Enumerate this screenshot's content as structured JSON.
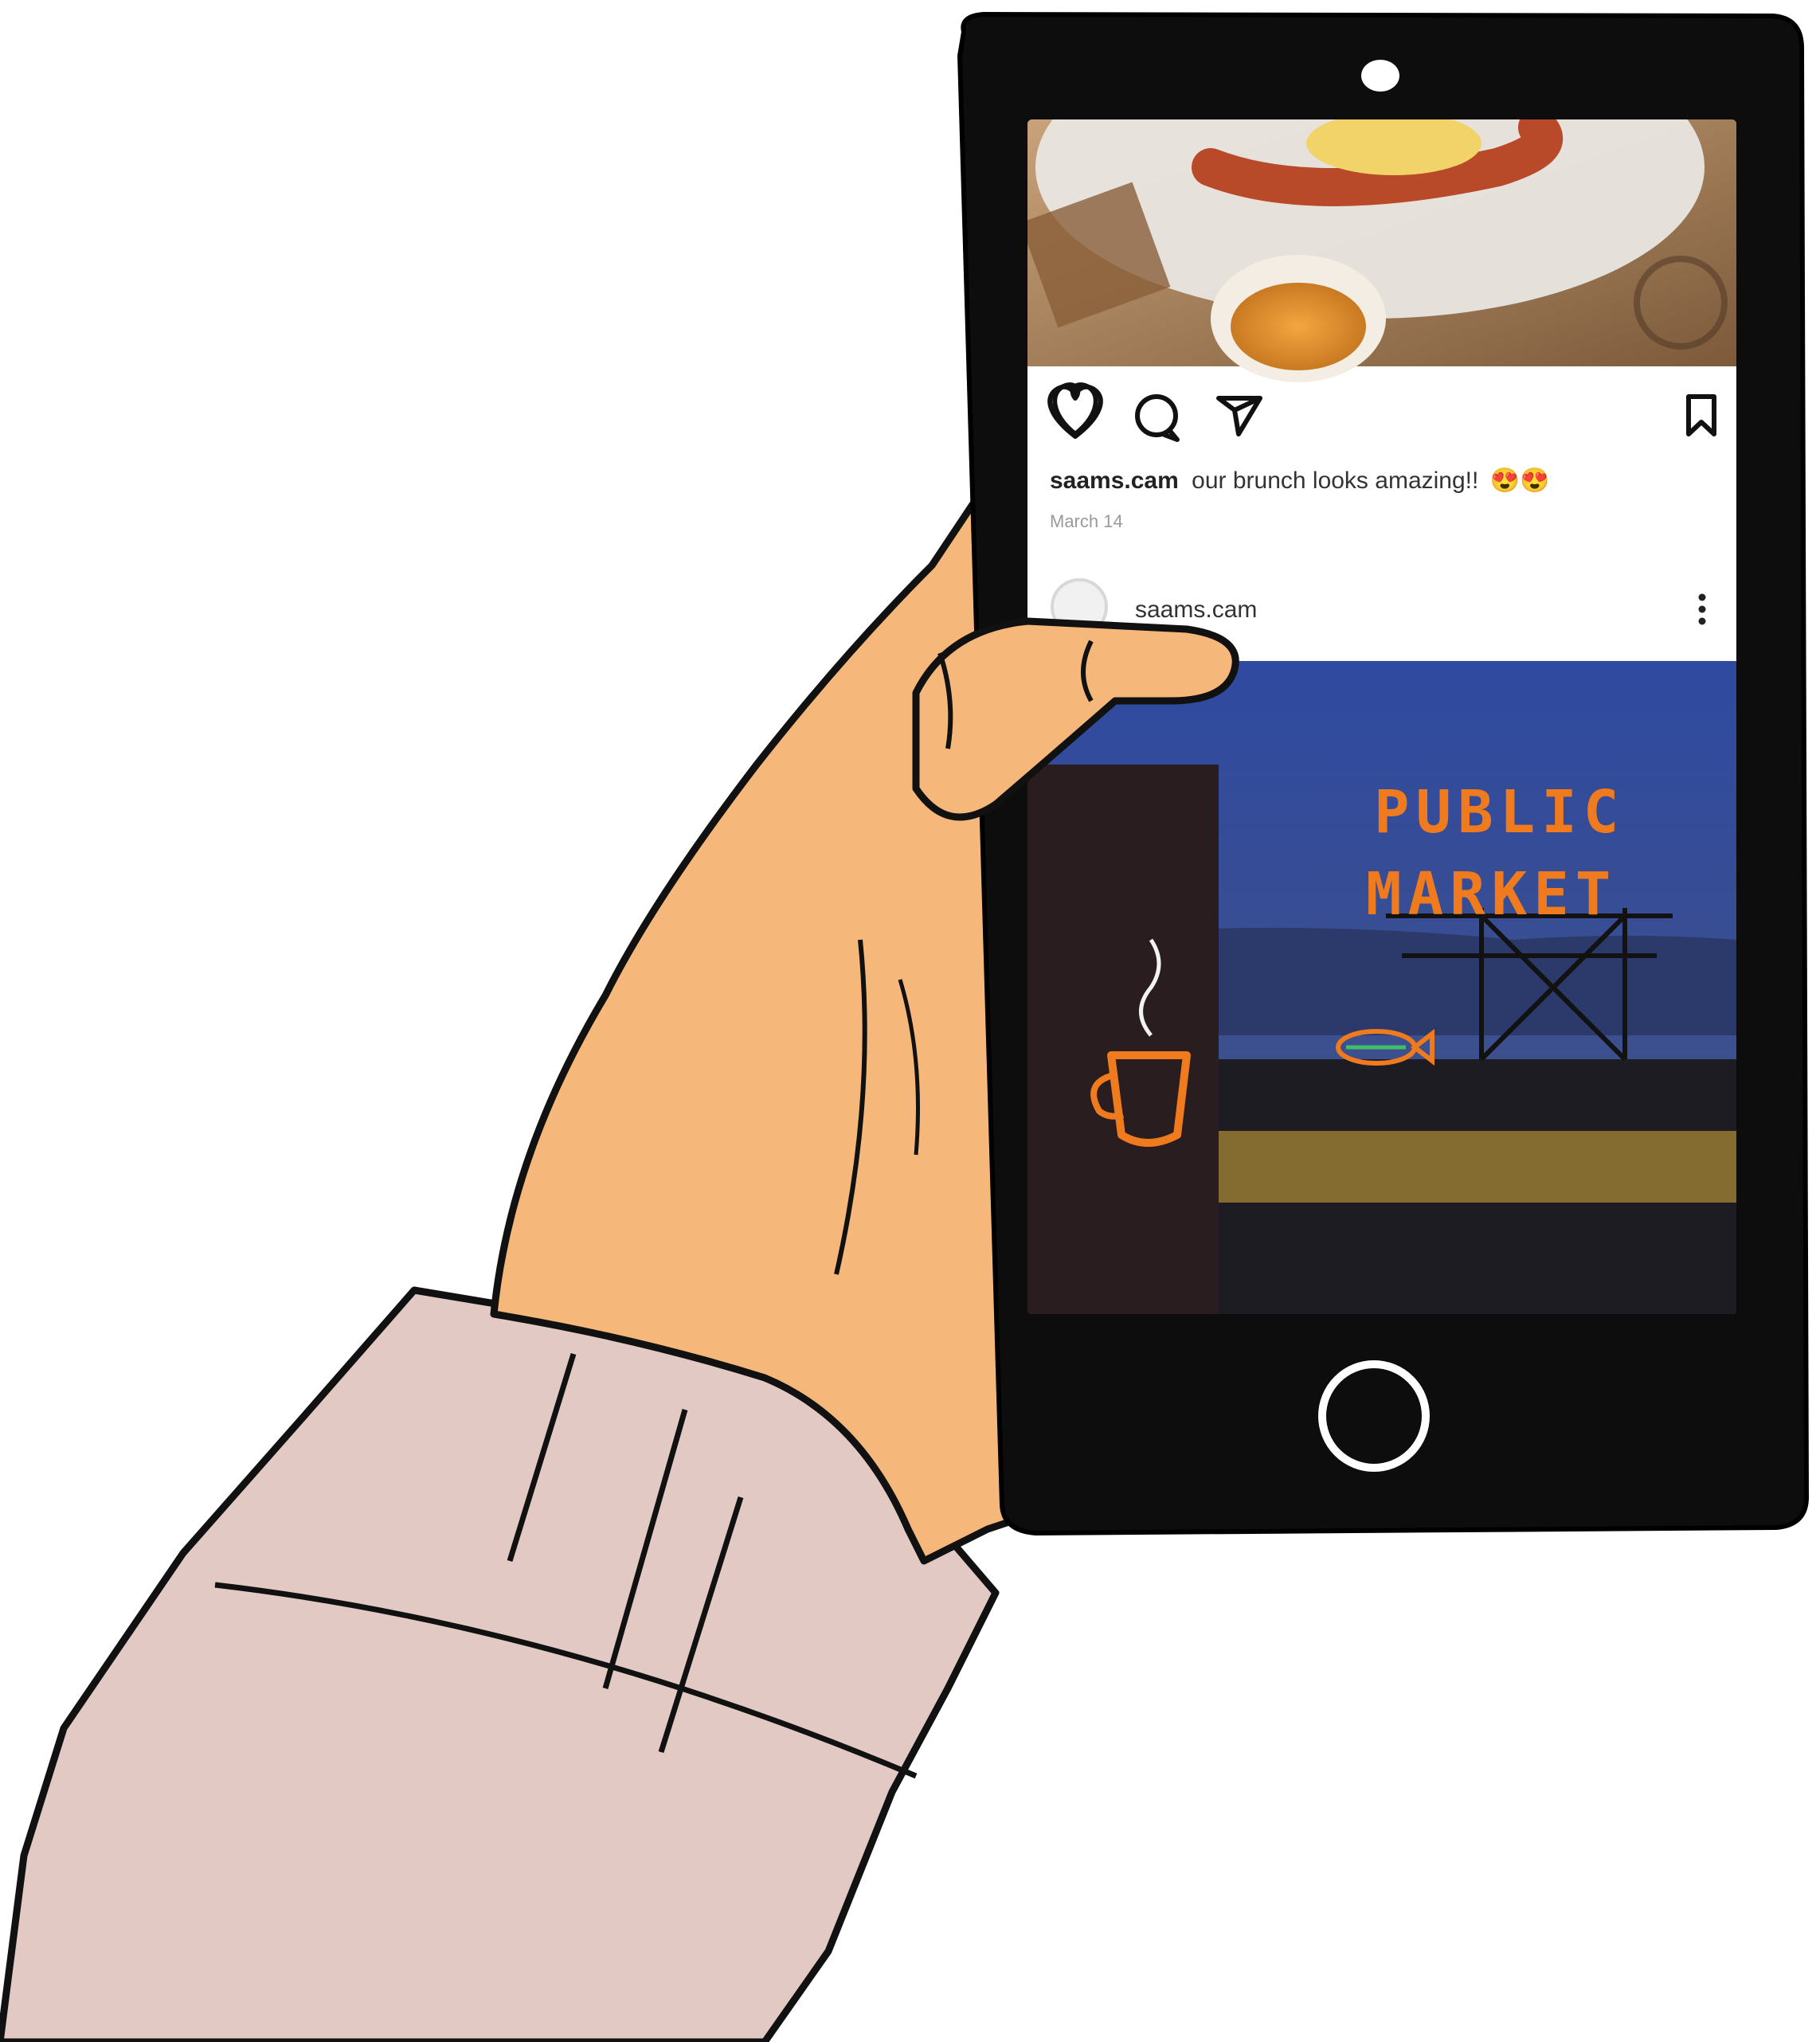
{
  "post": {
    "username": "saams.cam",
    "caption": "our brunch looks amazing!!",
    "caption_emoji": "😍😍",
    "date": "March 14"
  },
  "next_post": {
    "username": "saams.cam"
  },
  "photo": {
    "sign_line_1": "PUBLIC",
    "sign_line_2": "MARKET"
  },
  "icons": {
    "like": "heart-icon",
    "comment": "comment-bubble-icon",
    "share": "paper-plane-icon",
    "save": "bookmark-icon",
    "more": "vertical-dots-icon",
    "home": "home-button-icon",
    "camera": "front-camera-icon"
  },
  "colors": {
    "skin": "#f5b87a",
    "sleeve": "#e2c9c4",
    "phone_body": "#0d0d0d",
    "night_sky": "#3a4f9a",
    "neon_orange": "#f07a1e"
  }
}
